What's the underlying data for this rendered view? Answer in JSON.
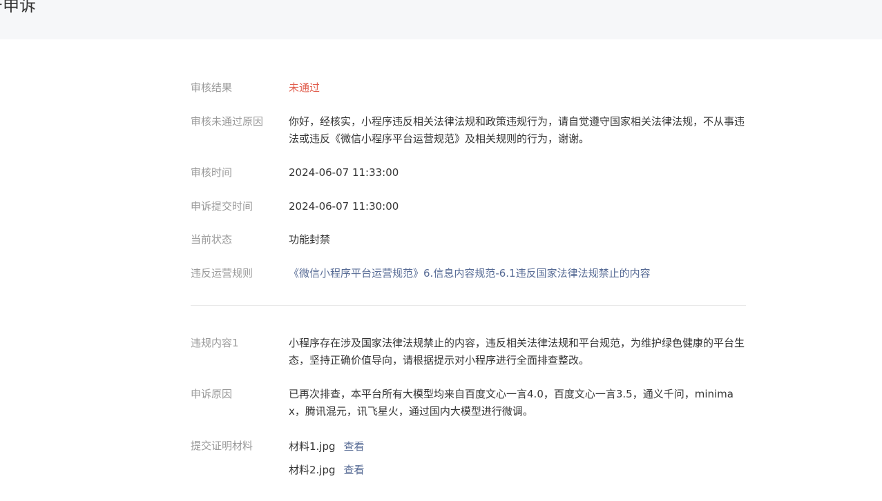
{
  "header": {
    "title": "号申诉"
  },
  "rows": {
    "result": {
      "label": "审核结果",
      "value": "未通过"
    },
    "reason": {
      "label": "审核未通过原因",
      "value": "你好，经核实，小程序违反相关法律法规和政策违规行为，请自觉遵守国家相关法律法规，不从事违法或违反《微信小程序平台运营规范》及相关规则的行为，谢谢。"
    },
    "review_time": {
      "label": "审核时间",
      "value": "2024-06-07 11:33:00"
    },
    "submit_time": {
      "label": "申诉提交时间",
      "value": "2024-06-07 11:30:00"
    },
    "status": {
      "label": "当前状态",
      "value": "功能封禁"
    },
    "rule": {
      "label": "违反运营规则",
      "value": "《微信小程序平台运营规范》6.信息内容规范-6.1违反国家法律法规禁止的内容"
    },
    "content1": {
      "label": "违规内容1",
      "value": "小程序存在涉及国家法律法规禁止的内容，违反相关法律法规和平台规范，为维护绿色健康的平台生态，坚持正确价值导向，请根据提示对小程序进行全面排查整改。"
    },
    "appeal_reason": {
      "label": "申诉原因",
      "value": "已再次排查，本平台所有大模型均来自百度文心一言4.0，百度文心一言3.5，通义千问，minimax，腾讯混元，讯飞星火，通过国内大模型进行微调。"
    },
    "materials": {
      "label": "提交证明材料",
      "files": [
        {
          "name": "材料1.jpg",
          "action": "查看"
        },
        {
          "name": "材料2.jpg",
          "action": "查看"
        }
      ]
    }
  },
  "colors": {
    "label": "#9a9a9a",
    "text": "#353535",
    "fail": "#e15f4f",
    "link": "#576b95",
    "header_bg": "#f6f7f9"
  }
}
